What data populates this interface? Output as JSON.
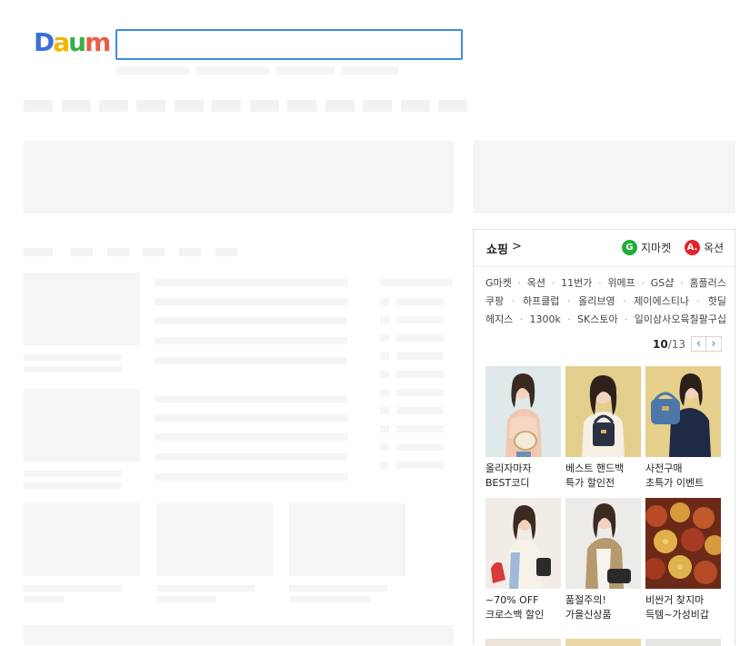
{
  "logo": {
    "text": "Daum",
    "letters": [
      "D",
      "a",
      "u",
      "m"
    ]
  },
  "search": {
    "value": "",
    "placeholder": ""
  },
  "shopping": {
    "title": "쇼핑",
    "title_arrow": ">",
    "brands": [
      {
        "badge": "G",
        "label": "지마켓",
        "color": "#1fae3c"
      },
      {
        "badge": "A.",
        "label": "옥션",
        "color": "#e4222c"
      }
    ],
    "link_rows": [
      [
        "G마켓",
        "옥션",
        "11번가",
        "위메프",
        "GS샵",
        "홈플러스"
      ],
      [
        "쿠팡",
        "하프클럽",
        "올리브영",
        "제이에스티나",
        "핫딜"
      ],
      [
        "헤지스",
        "1300k",
        "SK스토아",
        "일이삼사오육칠팔구십"
      ]
    ],
    "pager": {
      "current": "10",
      "total": "/13",
      "prev": "‹",
      "next": "›"
    },
    "items": [
      {
        "line1": "올리자마자",
        "line2": "BEST코디"
      },
      {
        "line1": "베스트 핸드백",
        "line2": "특가 할인전"
      },
      {
        "line1": "사전구매",
        "line2": "초특가 이벤트"
      },
      {
        "line1": "~70% OFF",
        "line2": "크로스백 할인"
      },
      {
        "line1": "품절주의!",
        "line2": "가을신상품"
      },
      {
        "line1": "비싼거 찾지마",
        "line2": "득템~가성비갑"
      }
    ]
  },
  "colors": {
    "accent": "#3b8ce6",
    "placeholder": "#f5f5f5"
  }
}
